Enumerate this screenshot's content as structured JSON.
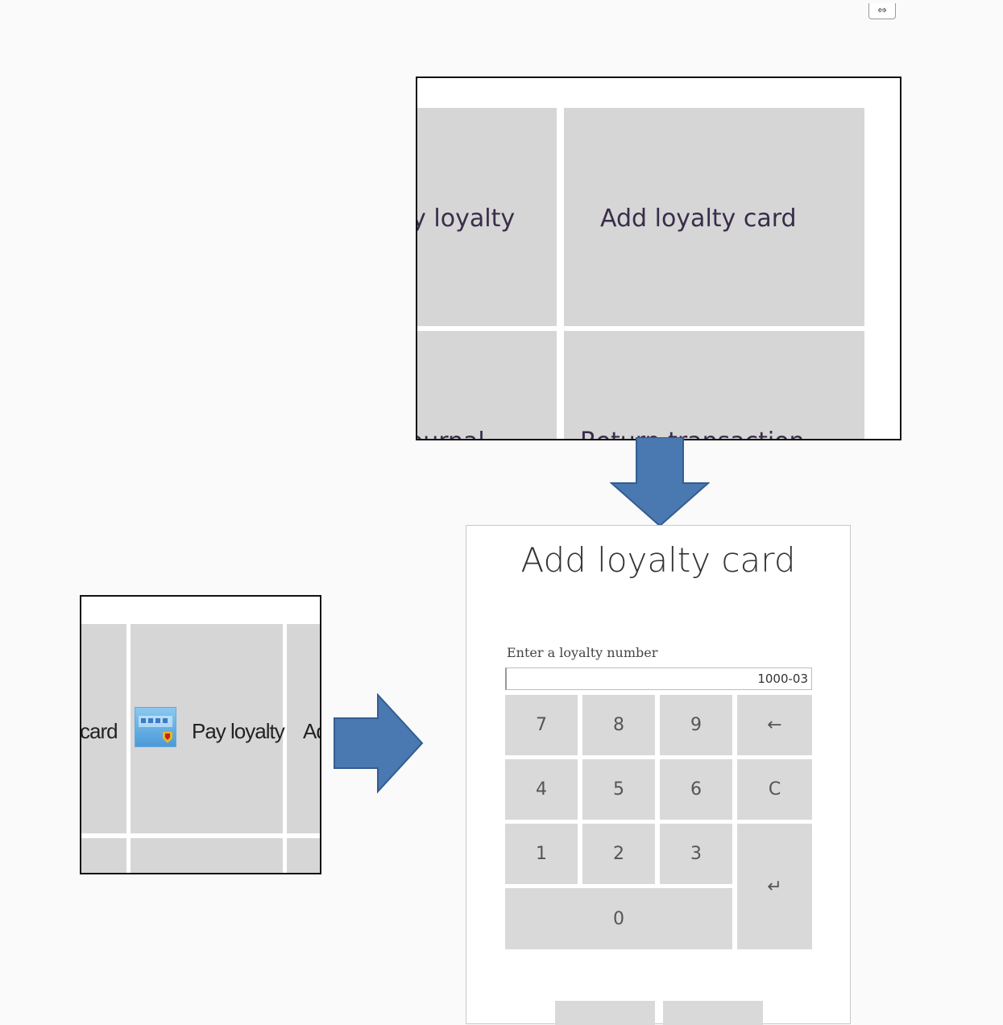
{
  "top_icon": {
    "glyph": "⇔",
    "icon": "resize-icon"
  },
  "zoom_top": {
    "tiles": [
      {
        "label": "Pay loyalty"
      },
      {
        "label": "Add loyalty card"
      },
      {
        "label": "Journal"
      },
      {
        "label": "Return transaction"
      }
    ]
  },
  "zoom_left": {
    "tiles": [
      {
        "label": "card"
      },
      {
        "label": "Pay loyalty",
        "icon": "loyalty-card-icon"
      },
      {
        "label": "Ad"
      }
    ]
  },
  "dialog": {
    "title": "Add loyalty card",
    "field_label": "Enter a loyalty number",
    "field_value": "1000-03",
    "keys": {
      "k7": "7",
      "k8": "8",
      "k9": "9",
      "backspace": "←",
      "k4": "4",
      "k5": "5",
      "k6": "6",
      "clear": "C",
      "k1": "1",
      "k2": "2",
      "k3": "3",
      "enter": "↵",
      "k0": "0"
    }
  },
  "colors": {
    "arrow": "#4a78b0",
    "tile": "#d6d6d6",
    "key": "#d9d9d9"
  }
}
